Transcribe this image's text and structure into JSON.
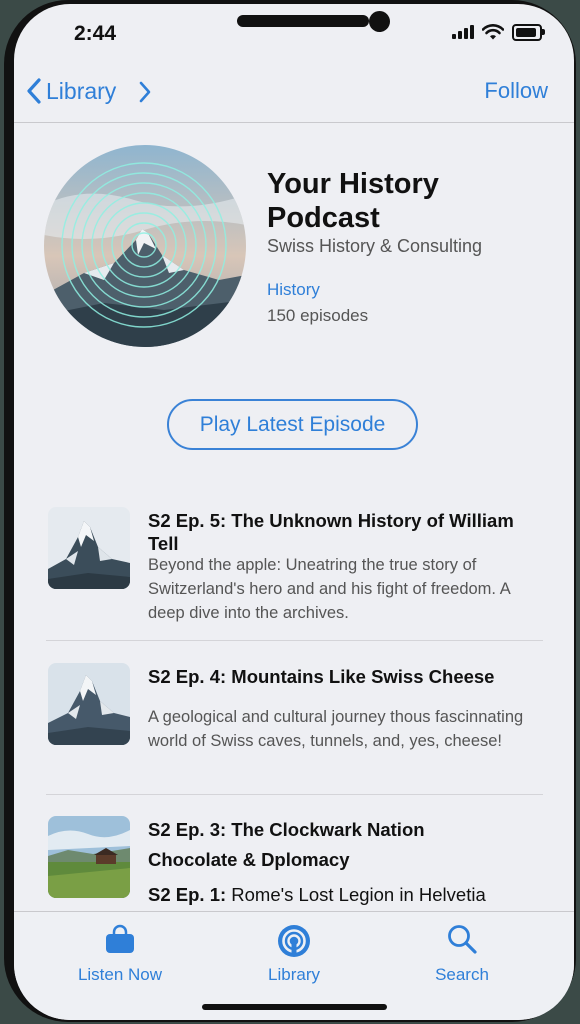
{
  "status_bar": {
    "time": "2:44"
  },
  "nav": {
    "back_label": "Library",
    "follow_label": "Follow"
  },
  "podcast": {
    "title": "Your History Podcast",
    "author": "Swiss History & Consulting",
    "category": "History",
    "episode_count": "150 episodes"
  },
  "play_button": {
    "label": "Play Latest Episode"
  },
  "episodes": [
    {
      "title": "S2 Ep. 5: The Unknown History of William Tell",
      "description": "Beyond the apple: Uneatring the true story of Switzerland's hero and and his fight of freedom. A deep dive into the archives."
    },
    {
      "title": "S2 Ep. 4: Mountains Like Swiss Cheese",
      "description": "A geological and cultural journey thous fascinnating world of Swiss caves, tunnels, and, yes, cheese!"
    },
    {
      "title": "S2 Ep. 3: The Clockwark Nation",
      "description": ""
    }
  ],
  "partial_lines": {
    "line1": "Chocolate & Dplomacy",
    "line2_prefix": "S2 Ep. 1:",
    "line2_rest": " Rome's Lost Legion in Helvetia"
  },
  "tabs": [
    {
      "label": "Listen Now",
      "icon": "bag-icon"
    },
    {
      "label": "Library",
      "icon": "podcast-icon"
    },
    {
      "label": "Search",
      "icon": "search-icon"
    }
  ],
  "colors": {
    "accent": "#2f7fd8",
    "background": "#eeeff3"
  }
}
